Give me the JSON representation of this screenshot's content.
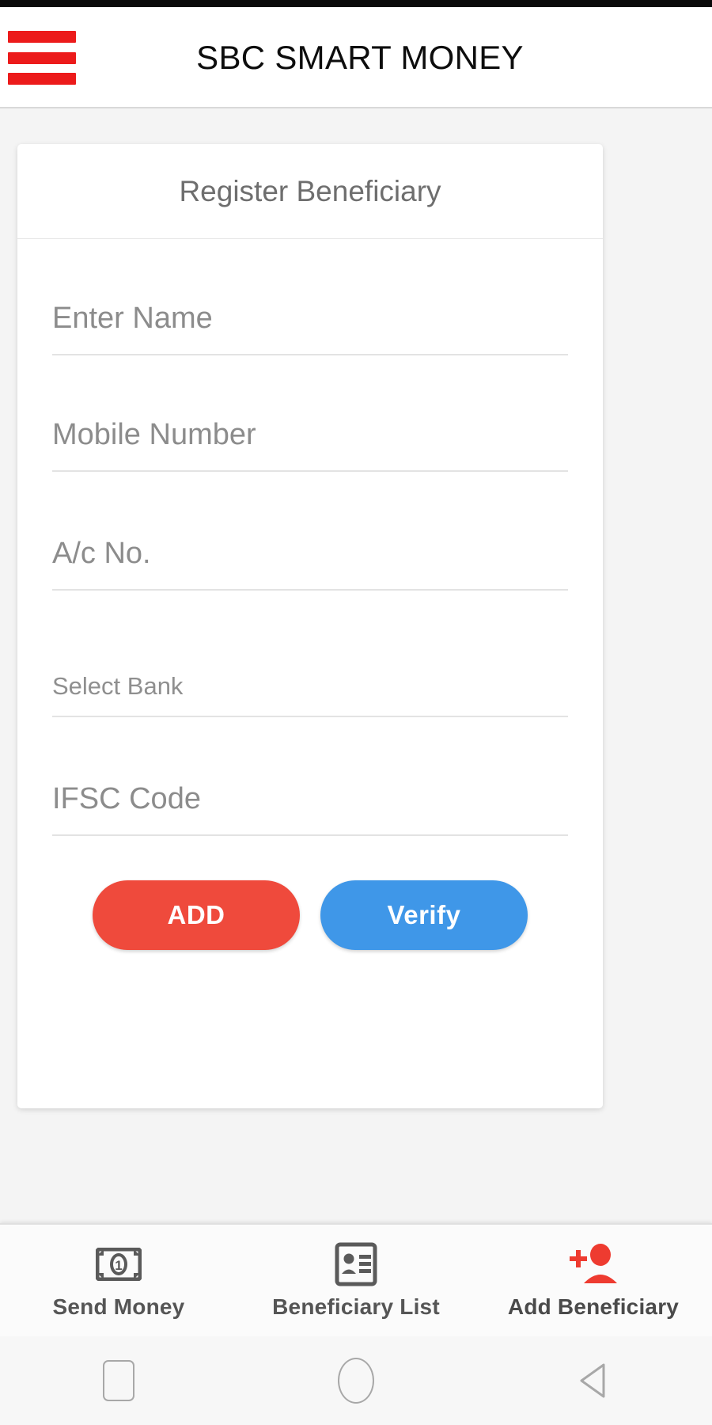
{
  "appbar": {
    "title": "SBC SMART MONEY",
    "menu_icon": "hamburger-menu-icon",
    "menu_color": "#ec1b1b"
  },
  "card": {
    "title": "Register Beneficiary",
    "fields": [
      {
        "name": "name",
        "placeholder": "Enter Name",
        "value": ""
      },
      {
        "name": "mobile",
        "placeholder": "Mobile Number",
        "value": ""
      },
      {
        "name": "acno",
        "placeholder": "A/c No.",
        "value": ""
      },
      {
        "name": "bank",
        "placeholder": "Select Bank",
        "value": ""
      },
      {
        "name": "ifsc",
        "placeholder": "IFSC Code",
        "value": ""
      }
    ],
    "buttons": {
      "add_label": "ADD",
      "add_color": "#ef4a3c",
      "verify_label": "Verify",
      "verify_color": "#3f97e8"
    }
  },
  "bottom_nav": {
    "items": [
      {
        "label": "Send Money",
        "icon": "banknote-icon",
        "active": false,
        "color": "#555555"
      },
      {
        "label": "Beneficiary List",
        "icon": "id-card-icon",
        "active": false,
        "color": "#555555"
      },
      {
        "label": "Add Beneficiary",
        "icon": "add-person-icon",
        "active": true,
        "color": "#ee3b30"
      }
    ]
  },
  "system_nav": {
    "recents": "square-icon",
    "home": "circle-icon",
    "back": "triangle-back-icon"
  }
}
